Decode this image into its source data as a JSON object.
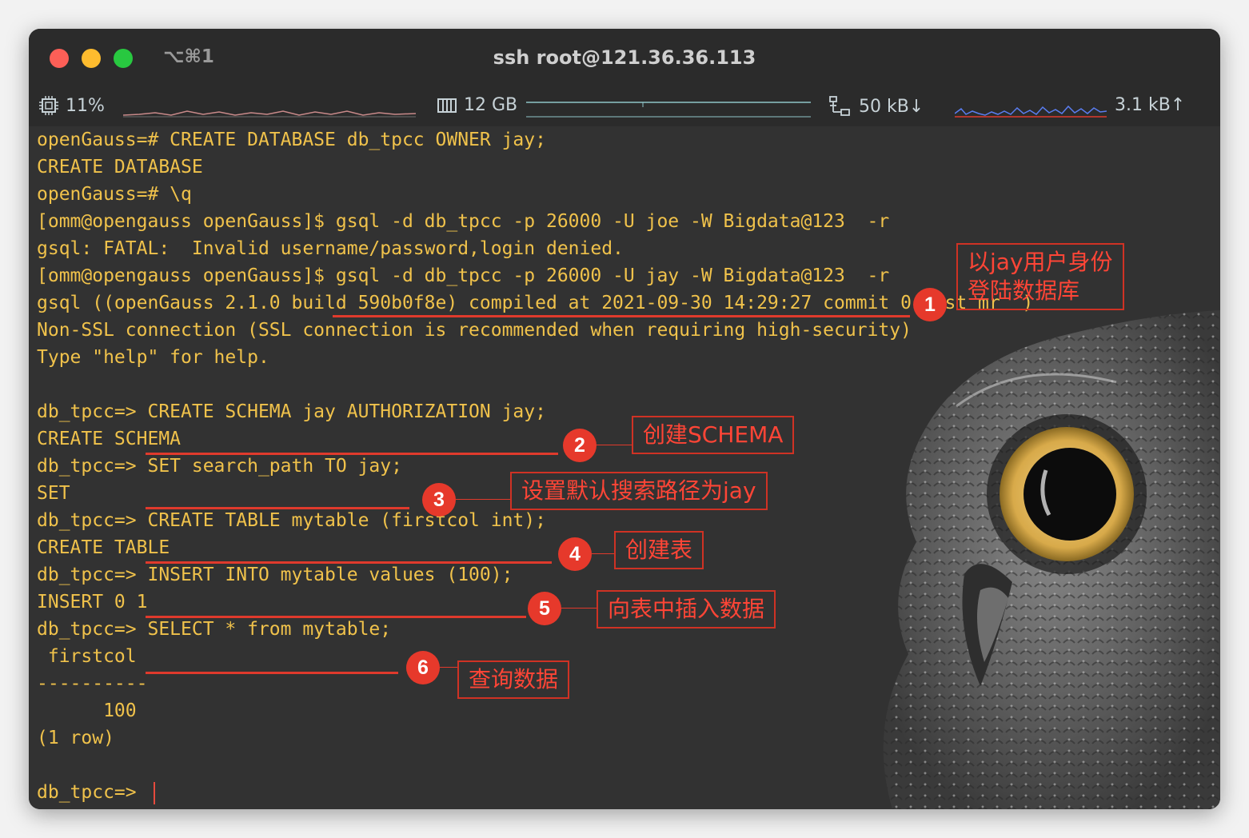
{
  "window": {
    "shortcut": "⌥⌘1",
    "title": "ssh root@121.36.36.113"
  },
  "status": {
    "cpu": "11%",
    "memory": "12 GB",
    "net_down": "50 kB↓",
    "net_up": "3.1 kB↑",
    "icons": [
      "cpu-chip-icon",
      "memory-icon",
      "network-icon"
    ]
  },
  "terminal": {
    "lines": [
      "openGauss=# CREATE DATABASE db_tpcc OWNER jay;",
      "CREATE DATABASE",
      "openGauss=# \\q",
      "[omm@opengauss openGauss]$ gsql -d db_tpcc -p 26000 -U joe -W Bigdata@123  -r",
      "gsql: FATAL:  Invalid username/password,login denied.",
      "[omm@opengauss openGauss]$ gsql -d db_tpcc -p 26000 -U jay -W Bigdata@123  -r",
      "gsql ((openGauss 2.1.0 build 590b0f8e) compiled at 2021-09-30 14:29:27 commit 0 last mr  )",
      "Non-SSL connection (SSL connection is recommended when requiring high-security)",
      "Type \"help\" for help.",
      "",
      "db_tpcc=> CREATE SCHEMA jay AUTHORIZATION jay;",
      "CREATE SCHEMA",
      "db_tpcc=> SET search_path TO jay;",
      "SET",
      "db_tpcc=> CREATE TABLE mytable (firstcol int);",
      "CREATE TABLE",
      "db_tpcc=> INSERT INTO mytable values (100);",
      "INSERT 0 1",
      "db_tpcc=> SELECT * from mytable;",
      " firstcol",
      "----------",
      "      100",
      "(1 row)",
      "",
      "db_tpcc=> "
    ]
  },
  "annotations": [
    {
      "num": "1",
      "text": "以jay用户身份\n登陆数据库"
    },
    {
      "num": "2",
      "text": "创建SCHEMA"
    },
    {
      "num": "3",
      "text": "设置默认搜索路径为jay"
    },
    {
      "num": "4",
      "text": "创建表"
    },
    {
      "num": "5",
      "text": "向表中插入数据"
    },
    {
      "num": "6",
      "text": "查询数据"
    }
  ],
  "colors": {
    "terminal_text": "#f0c24b",
    "annotation_red": "#e6392b",
    "terminal_bg": "#323232"
  }
}
